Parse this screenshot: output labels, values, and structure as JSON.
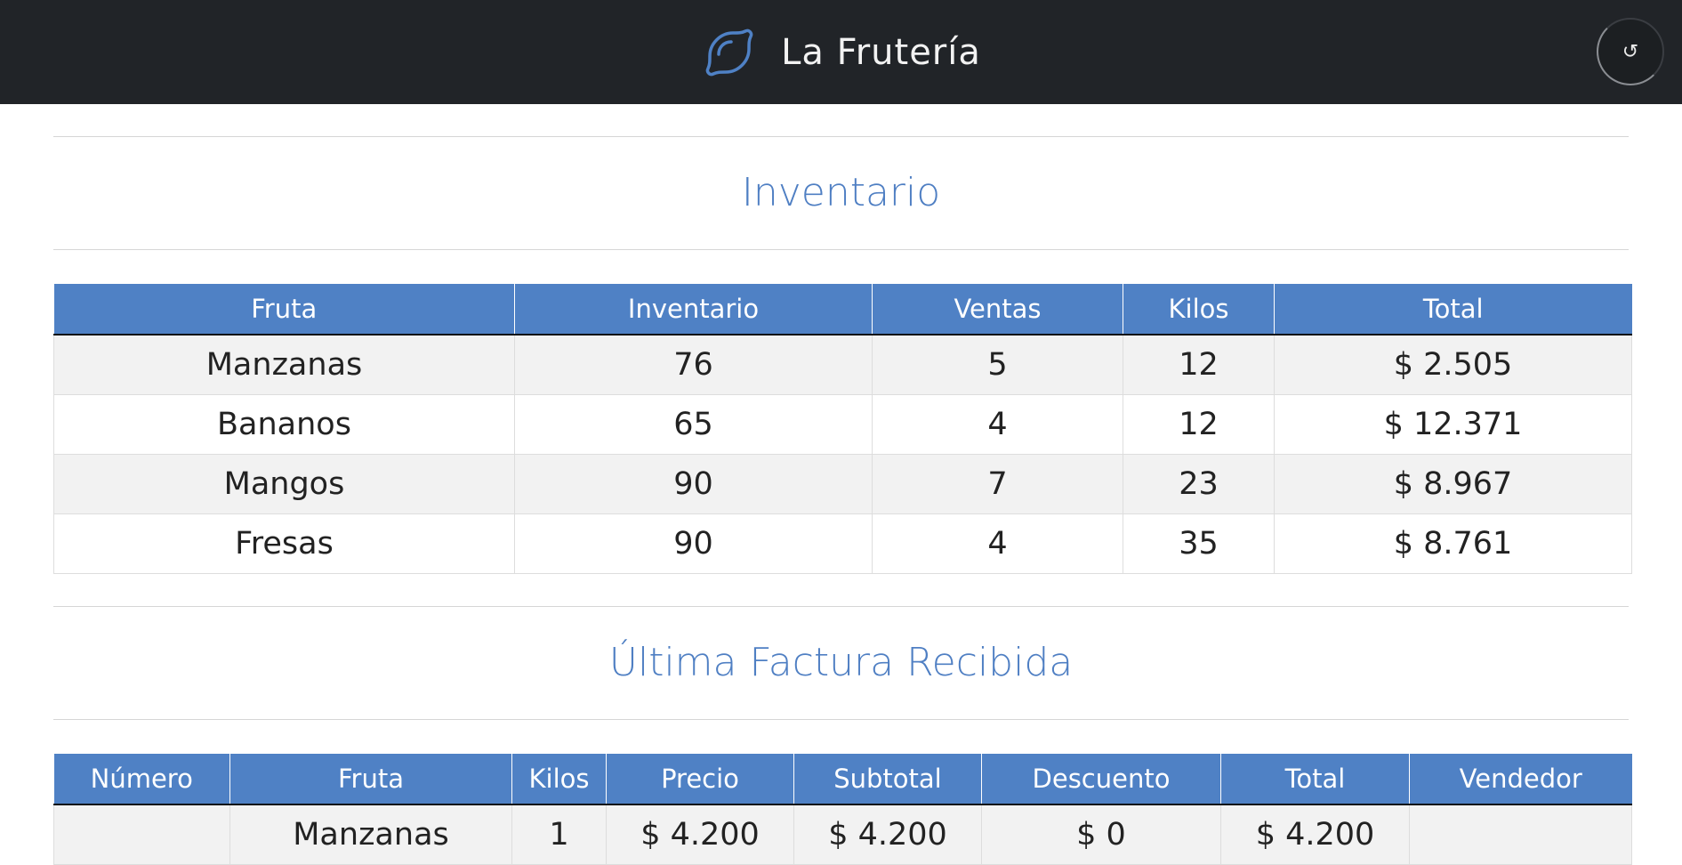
{
  "header": {
    "title": "La Frutería",
    "logo_icon": "lemon-icon",
    "refresh_icon": "refresh-icon",
    "refresh_symbol": "↺"
  },
  "inventory": {
    "heading": "Inventario",
    "columns": [
      "Fruta",
      "Inventario",
      "Ventas",
      "Kilos",
      "Total"
    ],
    "rows": [
      [
        "Manzanas",
        "76",
        "5",
        "12",
        "$ 2.505"
      ],
      [
        "Bananos",
        "65",
        "4",
        "12",
        "$ 12.371"
      ],
      [
        "Mangos",
        "90",
        "7",
        "23",
        "$ 8.967"
      ],
      [
        "Fresas",
        "90",
        "4",
        "35",
        "$ 8.761"
      ]
    ]
  },
  "invoice": {
    "heading": "Última Factura Recibida",
    "columns": [
      "Número",
      "Fruta",
      "Kilos",
      "Precio",
      "Subtotal",
      "Descuento",
      "Total",
      "Vendedor"
    ],
    "rows": [
      [
        "",
        "Manzanas",
        "1",
        "$ 4.200",
        "$ 4.200",
        "$ 0",
        "$ 4.200",
        ""
      ]
    ]
  },
  "colors": {
    "topbar": "#212428",
    "accent": "#4f81c5",
    "heading": "#4f7fc3",
    "row_alt": "#f2f2f2"
  }
}
